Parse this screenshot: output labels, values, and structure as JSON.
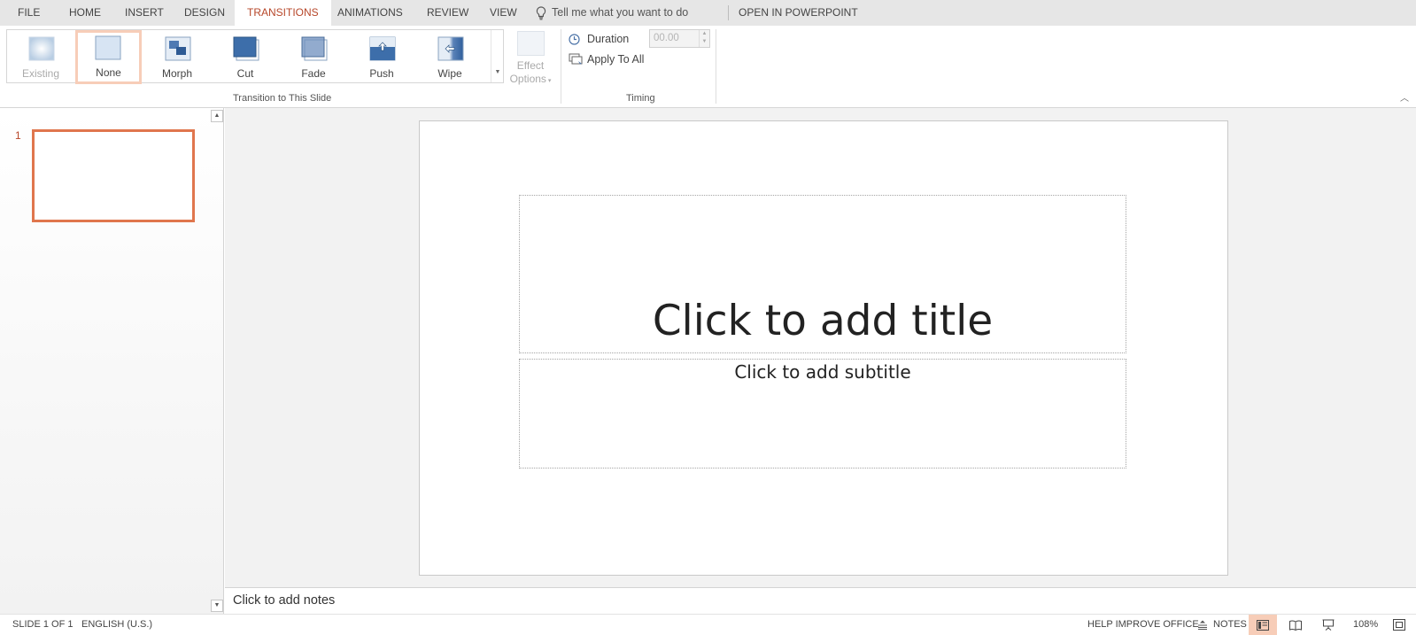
{
  "tabs": [
    {
      "label": "FILE"
    },
    {
      "label": "HOME"
    },
    {
      "label": "INSERT"
    },
    {
      "label": "DESIGN"
    },
    {
      "label": "TRANSITIONS",
      "active": true
    },
    {
      "label": "ANIMATIONS"
    },
    {
      "label": "REVIEW"
    },
    {
      "label": "VIEW"
    }
  ],
  "tell_me": "Tell me what you want to do",
  "open_in_app": "OPEN IN POWERPOINT",
  "ribbon": {
    "transitions": [
      {
        "label": "Existing",
        "icon": "existing-transition-icon",
        "disabled": true
      },
      {
        "label": "None",
        "icon": "none-transition-icon",
        "selected": true
      },
      {
        "label": "Morph",
        "icon": "morph-transition-icon"
      },
      {
        "label": "Cut",
        "icon": "cut-transition-icon"
      },
      {
        "label": "Fade",
        "icon": "fade-transition-icon"
      },
      {
        "label": "Push",
        "icon": "push-transition-icon"
      },
      {
        "label": "Wipe",
        "icon": "wipe-transition-icon"
      }
    ],
    "effect_options_line1": "Effect",
    "effect_options_line2": "Options",
    "group_transition": "Transition to This Slide",
    "duration_label": "Duration",
    "duration_value": "00.00",
    "apply_all": "Apply To All",
    "group_timing": "Timing"
  },
  "slides_pane": {
    "slide_number": "1"
  },
  "slide": {
    "title_placeholder": "Click to add title",
    "subtitle_placeholder": "Click to add subtitle"
  },
  "notes_placeholder": "Click to add notes",
  "status": {
    "slide_info": "SLIDE 1 OF 1",
    "language": "ENGLISH (U.S.)",
    "help": "HELP IMPROVE OFFICE",
    "notes": "NOTES",
    "zoom": "108%"
  },
  "colors": {
    "accent": "#b7472a",
    "selection": "#f7cdb8",
    "thumb_border": "#e0764d"
  }
}
